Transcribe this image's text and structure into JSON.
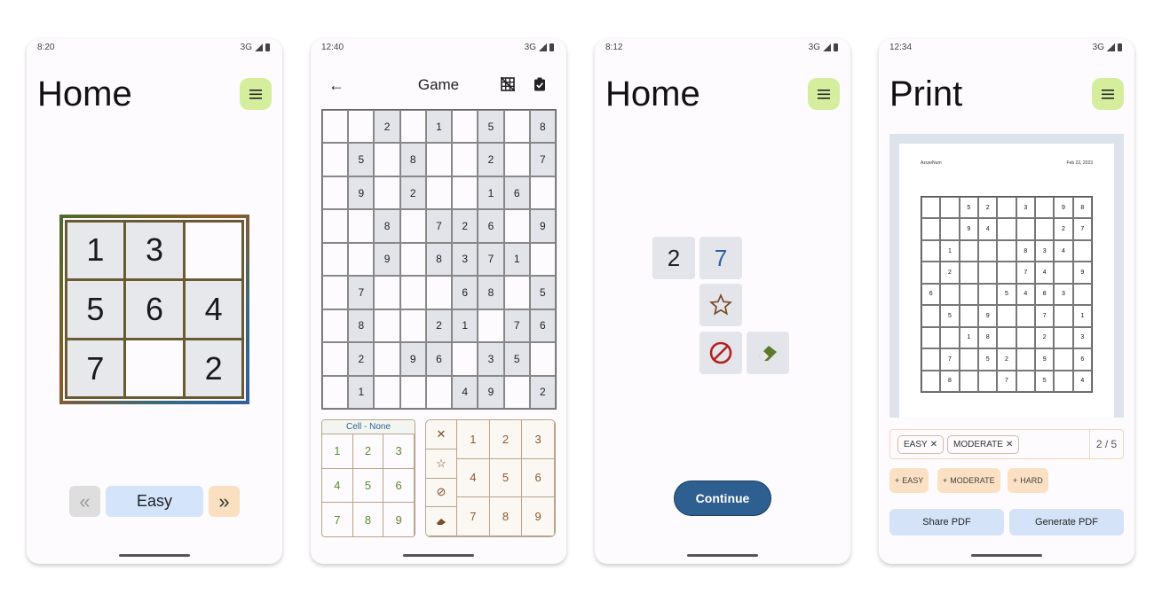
{
  "phone1": {
    "time": "8:20",
    "network": "3G",
    "title": "Home",
    "mini_grid": [
      "1",
      "3",
      "",
      "5",
      "6",
      "4",
      "7",
      "",
      "2"
    ],
    "difficulty": "Easy"
  },
  "phone2": {
    "time": "12:40",
    "network": "3G",
    "title": "Game",
    "sudoku": [
      [
        "",
        "",
        "2",
        "",
        "1",
        "",
        "5",
        "",
        "8"
      ],
      [
        "",
        "5",
        "",
        "8",
        "",
        "",
        "2",
        "",
        "7"
      ],
      [
        "",
        "9",
        "",
        "2",
        "",
        "",
        "1",
        "6",
        ""
      ],
      [
        "",
        "",
        "8",
        "",
        "7",
        "2",
        "6",
        "",
        "9"
      ],
      [
        "",
        "",
        "9",
        "",
        "8",
        "3",
        "7",
        "1",
        ""
      ],
      [
        "",
        "7",
        "",
        "",
        "",
        "6",
        "8",
        "",
        "5"
      ],
      [
        "",
        "8",
        "",
        "",
        "2",
        "1",
        "",
        "7",
        "6"
      ],
      [
        "",
        "2",
        "",
        "9",
        "6",
        "",
        "3",
        "5",
        ""
      ],
      [
        "",
        "1",
        "",
        "",
        "",
        "4",
        "9",
        "",
        "2"
      ]
    ],
    "cell_header": "Cell - None",
    "cell_nums": [
      "1",
      "2",
      "3",
      "4",
      "5",
      "6",
      "7",
      "8",
      "9"
    ],
    "tool_nums": [
      "1",
      "2",
      "3",
      "4",
      "5",
      "6",
      "7",
      "8",
      "9"
    ]
  },
  "phone3": {
    "time": "8:12",
    "network": "3G",
    "title": "Home",
    "tile_a": "2",
    "tile_b": "7",
    "continue": "Continue"
  },
  "phone4": {
    "time": "12:34",
    "network": "3G",
    "title": "Print",
    "paper_author": "AzureNum",
    "paper_date": "Feb 22, 2023",
    "print_grid": [
      [
        "",
        "",
        "5",
        "2",
        "",
        "3",
        "",
        "9",
        "8"
      ],
      [
        "",
        "",
        "9",
        "4",
        "",
        "",
        "",
        "2",
        "7"
      ],
      [
        "",
        "1",
        "",
        "",
        "",
        "8",
        "3",
        "4",
        ""
      ],
      [
        "",
        "2",
        "",
        "",
        "",
        "7",
        "4",
        "",
        "9"
      ],
      [
        "6",
        "",
        "",
        "",
        "5",
        "4",
        "8",
        "3",
        ""
      ],
      [
        "",
        "5",
        "",
        "9",
        "",
        "",
        "7",
        "",
        "1"
      ],
      [
        "",
        "",
        "1",
        "8",
        "",
        "",
        "2",
        "",
        "3"
      ],
      [
        "",
        "7",
        "",
        "5",
        "2",
        "",
        "9",
        "",
        "6"
      ],
      [
        "",
        "8",
        "",
        "",
        "7",
        "",
        "5",
        "",
        "4"
      ]
    ],
    "chip_easy": "EASY",
    "chip_moderate": "MODERATE",
    "page_count": "2 / 5",
    "add_easy": "EASY",
    "add_moderate": "MODERATE",
    "add_hard": "HARD",
    "share_pdf": "Share PDF",
    "generate_pdf": "Generate PDF"
  }
}
